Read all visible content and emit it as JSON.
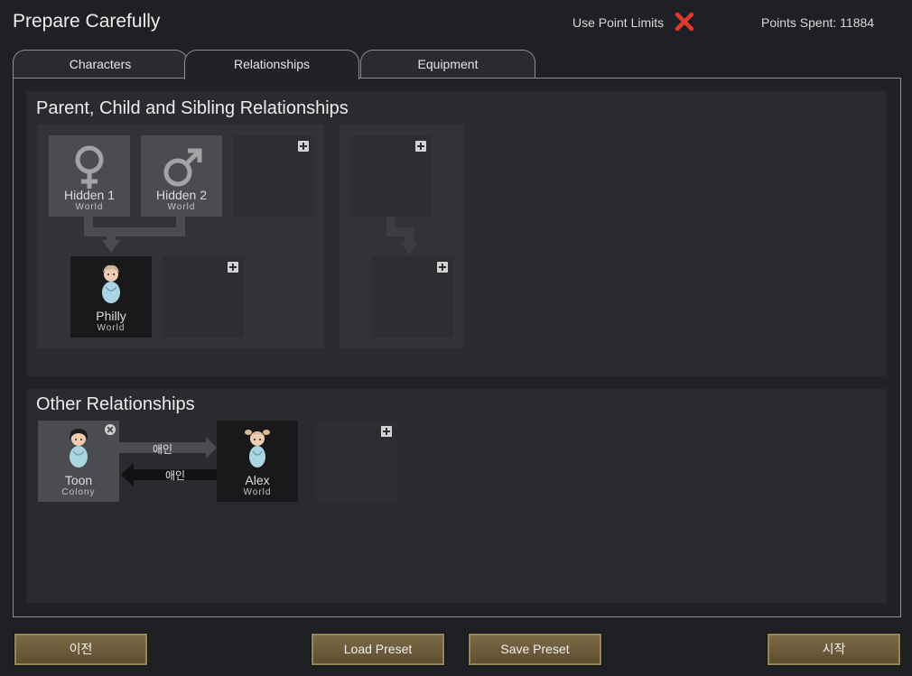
{
  "header": {
    "title": "Prepare Carefully",
    "use_point_limits_label": "Use Point Limits",
    "points_spent": "Points Spent: 11884"
  },
  "tabs": [
    {
      "label": "Characters",
      "active": false
    },
    {
      "label": "Relationships",
      "active": true
    },
    {
      "label": "Equipment",
      "active": false
    }
  ],
  "family_section": {
    "title": "Parent, Child and Sibling Relationships",
    "parents": [
      {
        "name": "Hidden 1",
        "sub": "World",
        "icon": "female-symbol-icon"
      },
      {
        "name": "Hidden 2",
        "sub": "World",
        "icon": "male-symbol-icon"
      }
    ],
    "children": [
      {
        "name": "Philly",
        "sub": "World",
        "icon": "pawn-portrait-icon"
      }
    ]
  },
  "other_section": {
    "title": "Other Relationships",
    "pawns": [
      {
        "name": "Toon",
        "sub": "Colony"
      },
      {
        "name": "Alex",
        "sub": "World"
      }
    ],
    "relation_forward": "애인",
    "relation_backward": "애인"
  },
  "footer": {
    "back_label": "이전",
    "load_preset_label": "Load Preset",
    "save_preset_label": "Save Preset",
    "start_label": "시작"
  },
  "colors": {
    "background": "#1f2023",
    "button": "#6e5e3c",
    "disabled_x": "#e03a2e"
  }
}
